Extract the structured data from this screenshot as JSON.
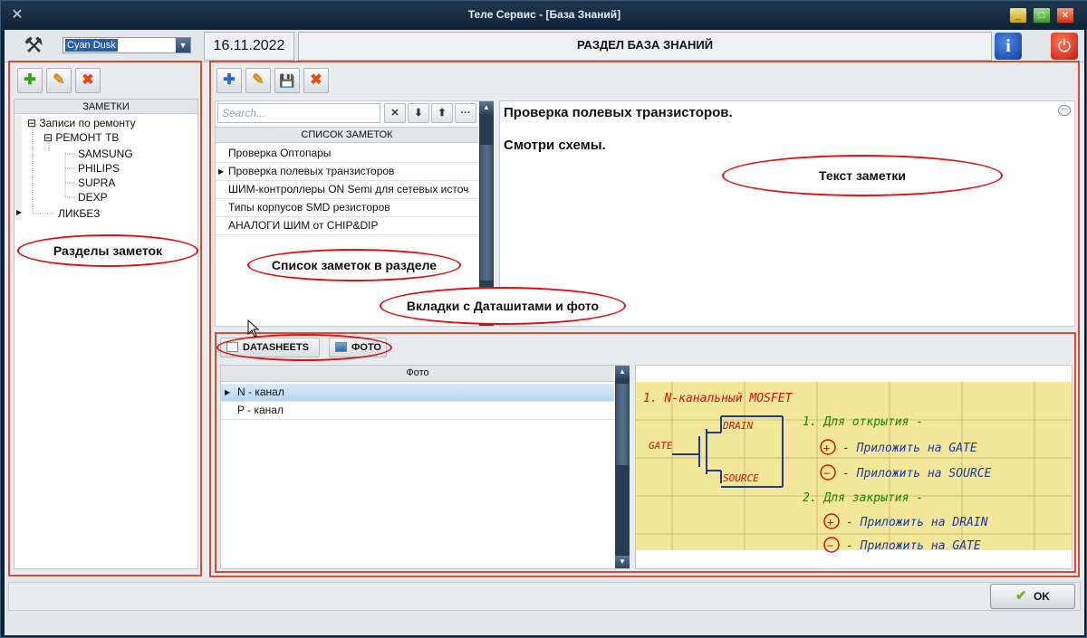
{
  "window": {
    "title": "Теле Сервис - [База Знаний]",
    "minimize_label": "_",
    "maximize_label": "□",
    "close_label": "×"
  },
  "header": {
    "theme_value": "Cyan Dusk",
    "date": "16.11.2022",
    "section_title": "РАЗДЕЛ БАЗА ЗНАНИЙ",
    "info_label": "i",
    "icons": {
      "tools": "tools-icon",
      "info": "info-icon",
      "power": "power-icon"
    }
  },
  "left_panel": {
    "toolbar": {
      "add_label": "✚",
      "edit_label": "✎",
      "delete_label": "✖"
    },
    "tree_header": "ЗАМЕТКИ",
    "tree": [
      {
        "label": "Записи по ремонту",
        "level": 0,
        "expander": "⊟"
      },
      {
        "label": "РЕМОНТ ТВ",
        "level": 1,
        "expander": "⊟"
      },
      {
        "label": "SAMSUNG",
        "level": 2
      },
      {
        "label": "PHILIPS",
        "level": 2
      },
      {
        "label": "SUPRA",
        "level": 2
      },
      {
        "label": "DEXP",
        "level": 2
      },
      {
        "label": "ЛИКБЕЗ",
        "level": 1,
        "selected": true
      }
    ]
  },
  "right_panel": {
    "toolbar": {
      "add_label": "✚",
      "edit_label": "✎",
      "save_label": "💾",
      "delete_label": "✖"
    },
    "search": {
      "placeholder": "Search...",
      "clear_label": "✕",
      "down_label": "⬇",
      "up_label": "⬆",
      "more_label": "···"
    },
    "list_header": "СПИСОК ЗАМЕТОК",
    "notes": [
      {
        "label": "Проверка Оптопары"
      },
      {
        "label": "Проверка полевых транзисторов",
        "selected": true
      },
      {
        "label": "ШИМ-контроллеры ON Semi для сетевых источ"
      },
      {
        "label": "Типы корпусов SMD резисторов"
      },
      {
        "label": "АНАЛОГИ ШИМ от CHIP&DIP"
      }
    ],
    "note_text": {
      "line1": "Проверка полевых транзисторов.",
      "line2": "Смотри схемы.",
      "more_label": "···"
    }
  },
  "tabs": {
    "items": [
      {
        "label": "DATASHEETS",
        "active": false
      },
      {
        "label": "ФОТО",
        "active": true
      }
    ],
    "photo_header": "Фото",
    "photos": [
      {
        "label": "N - канал",
        "selected": true
      },
      {
        "label": "P - канал"
      }
    ]
  },
  "photo_note": {
    "title": "1.   N-канальный  MOSFET",
    "drain": "DRAIN",
    "gate": "GATE",
    "source": "SOURCE",
    "open_title": "1. Для открытия -",
    "open_plus": "- Приложить на GATE",
    "open_minus": "- Приложить на SOURCE",
    "close_title": "2. Для закрытия -",
    "close_plus": "- Приложить на DRAIN",
    "close_minus": "- Приложить на GATE",
    "plus_sign": "+",
    "minus_sign": "−"
  },
  "callouts": {
    "sections": "Разделы заметок",
    "notes_list": "Список заметок в разделе",
    "tabs": "Вкладки с Даташитами и фото",
    "note_text": "Текст заметки"
  },
  "footer": {
    "ok_label": "OK",
    "ok_check": "✔"
  },
  "colors": {
    "accent_border": "#d84c34",
    "callout_border": "#e01010",
    "titlebar": "#0f2236"
  }
}
